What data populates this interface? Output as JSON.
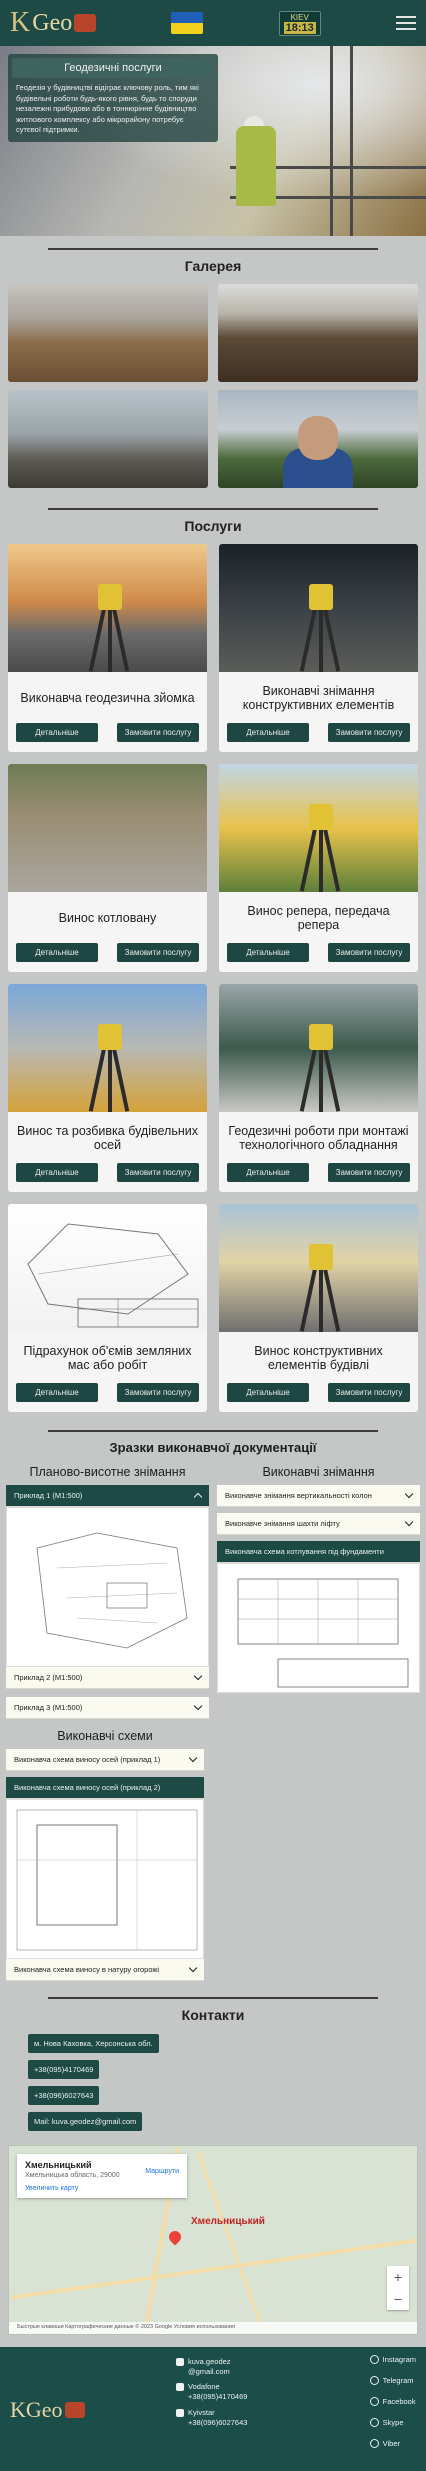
{
  "header": {
    "logo_text": "Geo",
    "logo_letter": "K",
    "clock_city": "KIEV",
    "clock_time": "18:13",
    "colors": {
      "bg": "#1d4a45",
      "flag_top": "#1f5fb7",
      "flag_bottom": "#f2d11c"
    }
  },
  "hero": {
    "card_title": "Геодезичні послуги",
    "card_text": "Геодезія у будівництві відіграє ключову роль, тим які будівельні роботи будь-якого рівня, будь то споруди незалежні прибудови або в тоннюрінне будівництво житлового комплексу або мікрорайону потребує сутєвої підтримки."
  },
  "gallery": {
    "title": "Галерея"
  },
  "services": {
    "title": "Послуги",
    "details_label": "Детальніше",
    "order_label": "Замовити послугу",
    "items": [
      {
        "title": "Виконавча геодезична зйомка"
      },
      {
        "title": "Виконавчі знімання конструктивних елементів"
      },
      {
        "title": "Винос котловану"
      },
      {
        "title": "Винос репера, передача репера"
      },
      {
        "title": "Винос та розбивка будівельних осей"
      },
      {
        "title": "Геодезичні роботи при монтажі технологічного обладнання"
      },
      {
        "title": "Підрахунок об'ємів земляних мас або робіт"
      },
      {
        "title": "Винос конструктивних елементів будівлі"
      }
    ]
  },
  "docs": {
    "title": "Зразки виконавчої документації",
    "left_title": "Планово-висотне знімання",
    "left_items": [
      {
        "label": "Приклад 1 (М1:500)",
        "active": true
      },
      {
        "label": "Приклад 2 (М1:500)"
      },
      {
        "label": "Приклад 3 (М1:500)"
      }
    ],
    "right_title": "Виконавчі знімання",
    "right_items": [
      {
        "label": "Виконавче знімання вертикальності колон"
      },
      {
        "label": "Виконавче знімання шахти ліфту"
      },
      {
        "label": "Виконавча схема котлування під фундаменти",
        "active": true
      }
    ],
    "schemes_title": "Виконавчі схеми",
    "schemes_items": [
      {
        "label": "Виконавча схема виносу осей (приклад 1)"
      },
      {
        "label": "Виконавча схема виносу осей (приклад 2)",
        "active": true
      },
      {
        "label": "Виконавча схема виносу в натуру огорожі"
      }
    ]
  },
  "contacts": {
    "title": "Контакти",
    "address": "м. Нова Каховка, Херсонська обл.",
    "phone1": "+38(095)4170469",
    "phone2": "+38(096)6027643",
    "mail": "Mail: kuva.geodez@gmail.com",
    "map": {
      "city": "Хмельницький",
      "sub": "Хмельницька область, 29000",
      "route": "Маршрути",
      "enlarge": "Увеличить карту",
      "label": "Хмельницький",
      "footer": "Быстрые клавиши   Картографические данные © 2023 Google   Условия использования"
    }
  },
  "footer": {
    "email_line1": "kuva.geodez",
    "email_line2": "@gmail.com",
    "vodafone_label": "Vodafone",
    "vodafone_phone": "+38(095)4170469",
    "kyivstar_label": "Kyivstar",
    "kyivstar_phone": "+38(096)6027643",
    "social": [
      "Instagram",
      "Telegram",
      "Facebook",
      "Skype",
      "Viber"
    ]
  }
}
